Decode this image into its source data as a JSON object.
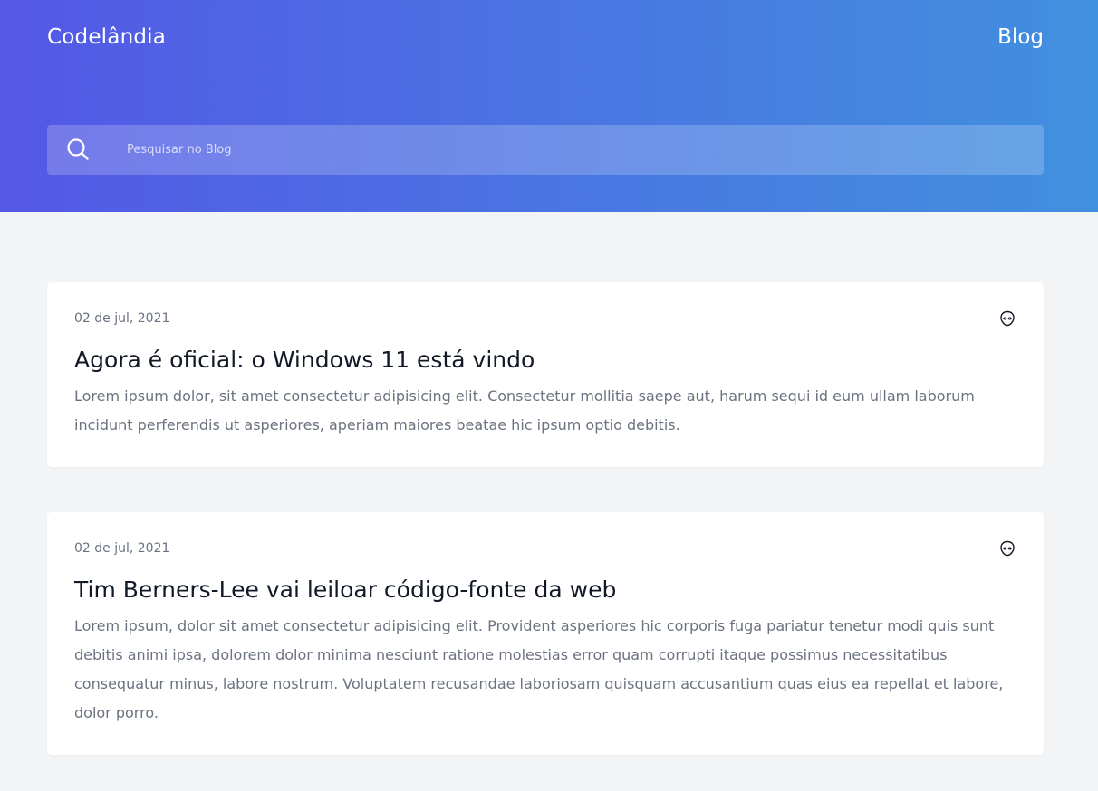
{
  "header": {
    "brand": "Codelândia",
    "nav_blog": "Blog"
  },
  "search": {
    "placeholder": "Pesquisar no Blog",
    "icon": "search-icon"
  },
  "posts": [
    {
      "date": "02 de jul, 2021",
      "title": "Agora é oficial: o Windows 11 está vindo",
      "excerpt": "Lorem ipsum dolor, sit amet consectetur adipisicing elit. Consectetur mollitia saepe aut, harum sequi id eum ullam laborum incidunt perferendis ut asperiores, aperiam maiores beatae hic ipsum optio debitis.",
      "icon": "alien-icon"
    },
    {
      "date": "02 de jul, 2021",
      "title": "Tim Berners-Lee vai leiloar código-fonte da web",
      "excerpt": "Lorem ipsum, dolor sit amet consectetur adipisicing elit. Provident asperiores hic corporis fuga pariatur tenetur modi quis sunt debitis animi ipsa, dolorem dolor minima nesciunt ratione molestias error quam corrupti itaque possimus necessitatibus consequatur minus, labore nostrum. Voluptatem recusandae laboriosam quisquam accusantium quas eius ea repellat et labore, dolor porro.",
      "icon": "alien-icon"
    }
  ],
  "colors": {
    "gradient_start": "#5458e6",
    "gradient_end": "#4190df",
    "page_background": "#f3f4f6",
    "card_background": "#ffffff",
    "title_text": "#111827",
    "body_text": "#6b7280"
  }
}
